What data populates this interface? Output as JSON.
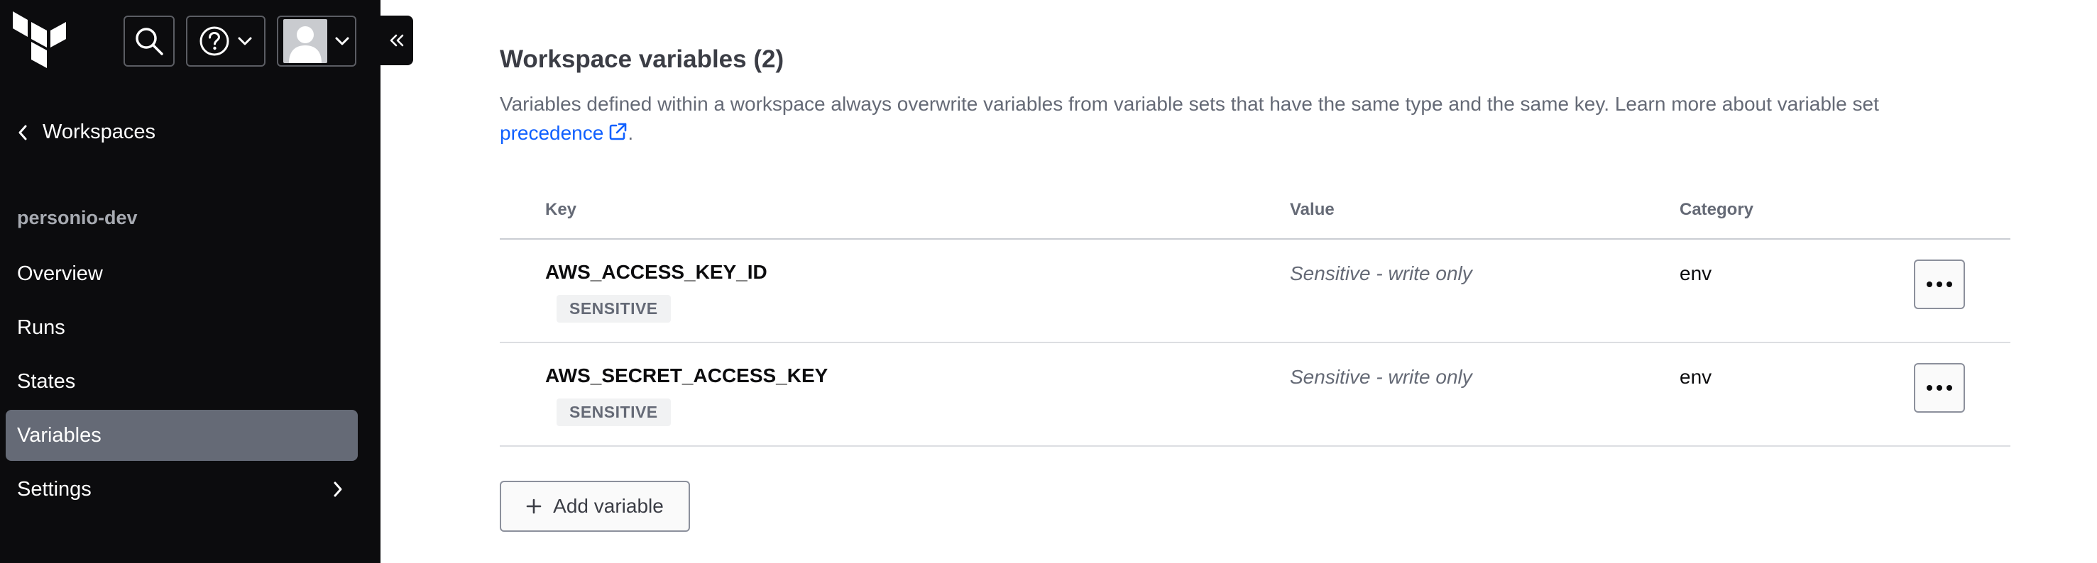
{
  "header": {
    "logo_icon": "terraform-logo-icon",
    "search_icon": "search-icon",
    "help_icon": "help-circle-icon",
    "user_icon": "user-avatar-icon",
    "collapse_icon": "double-chevron-left-icon"
  },
  "sidebar": {
    "back_label": "Workspaces",
    "workspace_name": "personio-dev",
    "items": [
      {
        "label": "Overview",
        "active": false
      },
      {
        "label": "Runs",
        "active": false
      },
      {
        "label": "States",
        "active": false
      },
      {
        "label": "Variables",
        "active": true
      },
      {
        "label": "Settings",
        "active": false,
        "has_submenu": true
      }
    ]
  },
  "main": {
    "title": "Workspace variables (2)",
    "description_prefix": "Variables defined within a workspace always overwrite variables from variable sets that have the same type and the same key. Learn more about variable set ",
    "description_link": "precedence",
    "description_suffix": ".",
    "table": {
      "columns": [
        "Key",
        "Value",
        "Category"
      ],
      "rows": [
        {
          "key": "AWS_ACCESS_KEY_ID",
          "badge": "SENSITIVE",
          "value": "Sensitive - write only",
          "category": "env"
        },
        {
          "key": "AWS_SECRET_ACCESS_KEY",
          "badge": "SENSITIVE",
          "value": "Sensitive - write only",
          "category": "env"
        }
      ]
    },
    "add_button_label": "Add variable"
  },
  "colors": {
    "sidebar_bg": "#0c0c0e",
    "active_item_bg": "#656a76",
    "link": "#1060ff",
    "muted_text": "#656a76"
  }
}
